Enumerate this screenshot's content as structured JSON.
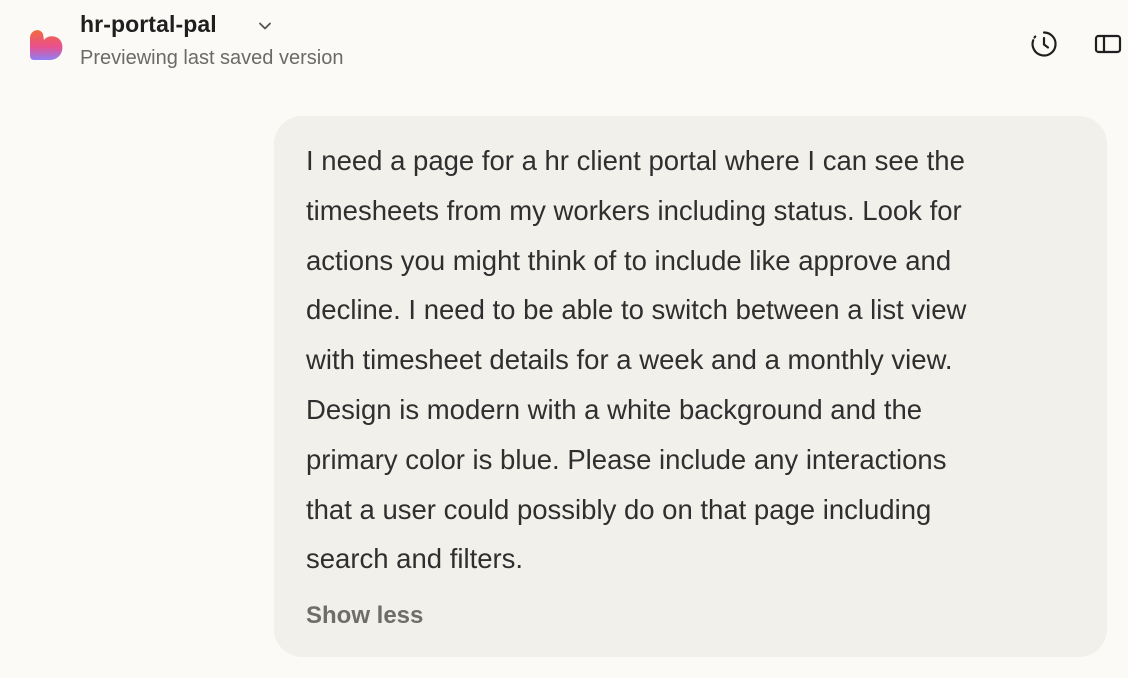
{
  "header": {
    "project_name": "hr-portal-pal",
    "subtitle": "Previewing last saved version",
    "icons": {
      "logo": "heart-logo-icon",
      "project_menu": "chevron-down-icon",
      "history": "history-icon",
      "sidebar": "sidebar-toggle-icon"
    }
  },
  "message": {
    "lines": [
      "I need a page for a hr client portal where I can see the",
      "timesheets from my workers including status. Look for",
      "actions you might think of to include like approve and",
      "decline. I need to be able to switch between a list view",
      "with timesheet details for a week and a monthly view.",
      "Design is modern with a white background and the",
      "primary color is blue. Please include any interactions",
      "that a user could possibly do on that page including",
      "search and filters."
    ],
    "toggle_label": "Show less"
  },
  "colors": {
    "background": "#fbfaf7",
    "bubble": "#f2f0eb",
    "logo_gradient": [
      "#f26a3d",
      "#e84a8a",
      "#8a7cf5"
    ]
  }
}
